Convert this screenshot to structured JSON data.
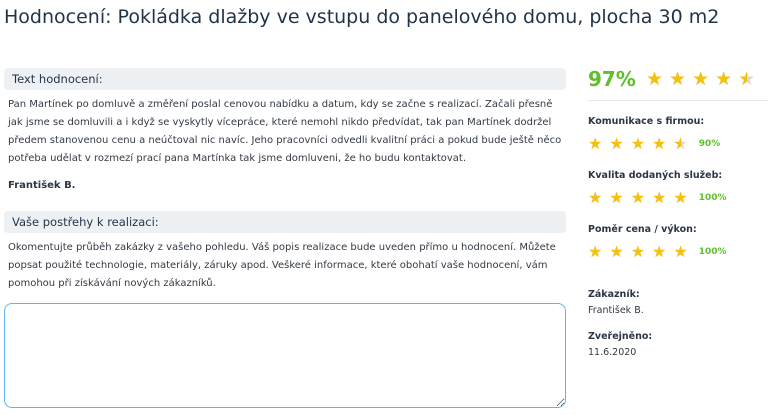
{
  "page_title": "Hodnocení: Pokládka dlažby ve vstupu do panelového domu, plocha 30 m2",
  "review": {
    "heading": "Text hodnocení:",
    "text": "Pan Martínek po domluvě a změření poslal cenovou nabídku a datum, kdy se začne s realizací. Začali přesně jak jsme se domluvili a i když se vyskytly vícepráce, které nemohl nikdo předvídat, tak pan Martínek dodržel předem stanovenou cenu a neúčtoval nic navíc. Jeho pracovníci odvedli kvalitní práci a pokud bude ještě něco potřeba udělat v rozmezí prací pana Martínka tak jsme domluveni, že ho budu kontaktovat.",
    "author": "František B."
  },
  "observations": {
    "heading": "Vaše postřehy k realizaci:",
    "text": "Okomentujte průběh zakázky z vašeho pohledu. Váš popis realizace bude uveden přímo u hodnocení. Můžete popsat použité technologie, materiály, záruky apod. Veškeré informace, které obohatí vaše hodnocení, vám pomohou při získávání nových zákazníků.",
    "textarea_value": ""
  },
  "summary": {
    "overall_percent": "97%",
    "overall_stars": 4.5,
    "criteria": [
      {
        "label": "Komunikace s firmou:",
        "percent": "90%",
        "stars": 4.5
      },
      {
        "label": "Kvalita dodaných služeb:",
        "percent": "100%",
        "stars": 5
      },
      {
        "label": "Poměr cena / výkon:",
        "percent": "100%",
        "stars": 5
      }
    ],
    "customer_label": "Zákazník:",
    "customer_value": "František B.",
    "published_label": "Zveřejněno:",
    "published_value": "11.6.2020"
  },
  "colors": {
    "accent_green": "#5fbf2d",
    "star_gold": "#f5c10f",
    "star_empty": "#d9d9d9",
    "textarea_border": "#5bb8e8"
  },
  "icons": {
    "star": "star-icon",
    "half_star": "star-half-icon"
  }
}
